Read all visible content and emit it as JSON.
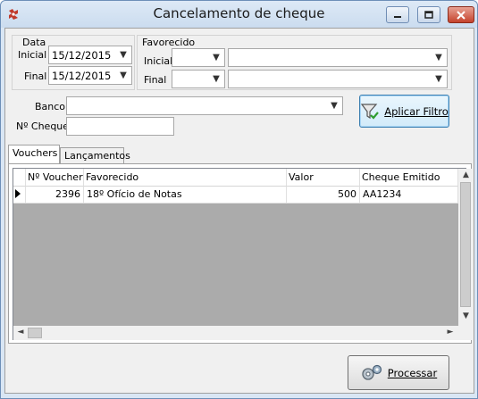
{
  "window": {
    "title": "Cancelamento de cheque",
    "icons": {
      "app": "checks-app-icon",
      "minimize": "minimize-icon",
      "maximize": "maximize-icon",
      "close": "close-icon"
    }
  },
  "filters": {
    "data": {
      "group_label": "Data",
      "inicial_label": "Inicial",
      "inicial_value": "15/12/2015",
      "final_label": "Final",
      "final_value": "15/12/2015"
    },
    "favorecido": {
      "group_label": "Favorecido",
      "inicial_label": "Inicial",
      "final_label": "Final",
      "inicial_code": "",
      "inicial_name": "",
      "final_code": "",
      "final_name": ""
    },
    "banco_label": "Banco",
    "banco_value": "",
    "cheque_label": "Nº Cheque",
    "cheque_value": "",
    "apply_button": "Aplicar Filtro"
  },
  "tabs": [
    {
      "label": "Vouchers",
      "active": true
    },
    {
      "label": "Lançamentos",
      "active": false
    }
  ],
  "grid": {
    "columns": [
      "Nº Voucher",
      "Favorecido",
      "Valor",
      "Cheque Emitido"
    ],
    "rows": [
      {
        "voucher": "2396",
        "favorecido": "18º Ofício de Notas",
        "valor": "500",
        "cheque": "AA1234"
      }
    ]
  },
  "footer": {
    "process_button": "Processar"
  },
  "colors": {
    "window_border": "#6d8fb8",
    "close_button": "#c4422c",
    "grid_bg": "#ababab",
    "focus_border": "#3c7fb1"
  }
}
